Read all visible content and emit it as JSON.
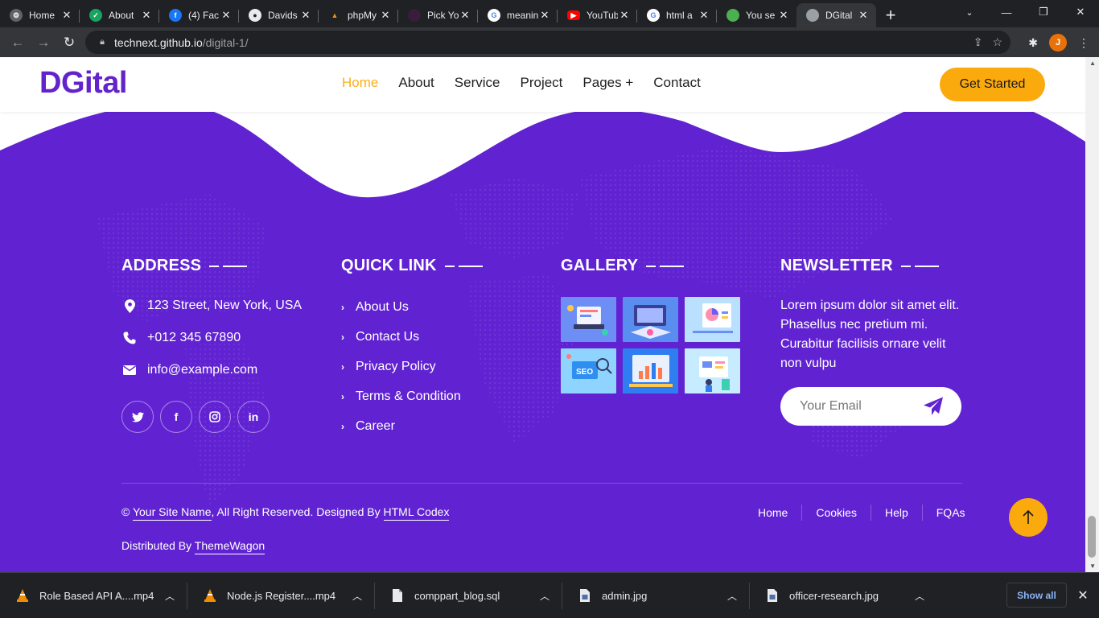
{
  "browser": {
    "tabs": [
      {
        "title": "Home",
        "favicon": "gear-icon",
        "color": "#5f6368"
      },
      {
        "title": "About",
        "favicon": "check-circle-icon",
        "color": "#1aa260"
      },
      {
        "title": "(4) Fac",
        "favicon": "facebook-icon",
        "color": "#1877f2"
      },
      {
        "title": "Davids",
        "favicon": "github-icon",
        "color": "#24292e"
      },
      {
        "title": "phpMy",
        "favicon": "phpmyadmin-icon",
        "color": "#f29111"
      },
      {
        "title": "Pick Yo",
        "favicon": "figma-icon",
        "color": "#3a1d3a"
      },
      {
        "title": "meanin",
        "favicon": "google-icon",
        "color": "#ffffff"
      },
      {
        "title": "YouTub",
        "favicon": "youtube-icon",
        "color": "#ff0000"
      },
      {
        "title": "html a",
        "favicon": "google-icon",
        "color": "#ffffff"
      },
      {
        "title": "You se",
        "favicon": "leaf-icon",
        "color": "#4caf50"
      },
      {
        "title": "DGital",
        "favicon": "globe-icon",
        "color": "#9aa0a6"
      }
    ],
    "new_tab": "+",
    "url_host": "technext.github.io",
    "url_path": "/digital-1/",
    "profile_initial": "J"
  },
  "site": {
    "logo": "DGital",
    "nav": [
      "Home",
      "About",
      "Service",
      "Project",
      "Pages +",
      "Contact"
    ],
    "cta": "Get Started",
    "accent": "#fbaa0d",
    "brand": "#6222cc"
  },
  "footer": {
    "address": {
      "title": "ADDRESS",
      "street": "123 Street, New York, USA",
      "phone": "+012 345 67890",
      "email": "info@example.com"
    },
    "quick_link": {
      "title": "QUICK LINK",
      "links": [
        "About Us",
        "Contact Us",
        "Privacy Policy",
        "Terms & Condition",
        "Career"
      ]
    },
    "gallery": {
      "title": "GALLERY",
      "images": [
        "gallery-image-1",
        "gallery-image-2",
        "gallery-image-3",
        "gallery-image-4",
        "gallery-image-5",
        "gallery-image-6"
      ]
    },
    "newsletter": {
      "title": "NEWSLETTER",
      "text": "Lorem ipsum dolor sit amet elit. Phasellus nec pretium mi. Curabitur facilisis ornare velit non vulpu",
      "placeholder": "Your Email"
    },
    "copyright": {
      "prefix": "© ",
      "site_name": "Your Site Name",
      "middle": ", All Right Reserved. Designed By ",
      "designer": "HTML Codex"
    },
    "distributed": {
      "prefix": "Distributed By ",
      "name": "ThemeWagon"
    },
    "nav": [
      "Home",
      "Cookies",
      "Help",
      "FQAs"
    ]
  },
  "downloads": {
    "items": [
      {
        "name": "Role Based API A....mp4",
        "icon": "vlc-icon"
      },
      {
        "name": "Node.js Register....mp4",
        "icon": "vlc-icon"
      },
      {
        "name": "comppart_blog.sql",
        "icon": "file-icon"
      },
      {
        "name": "admin.jpg",
        "icon": "image-file-icon"
      },
      {
        "name": "officer-research.jpg",
        "icon": "image-file-icon"
      }
    ],
    "show_all": "Show all"
  }
}
